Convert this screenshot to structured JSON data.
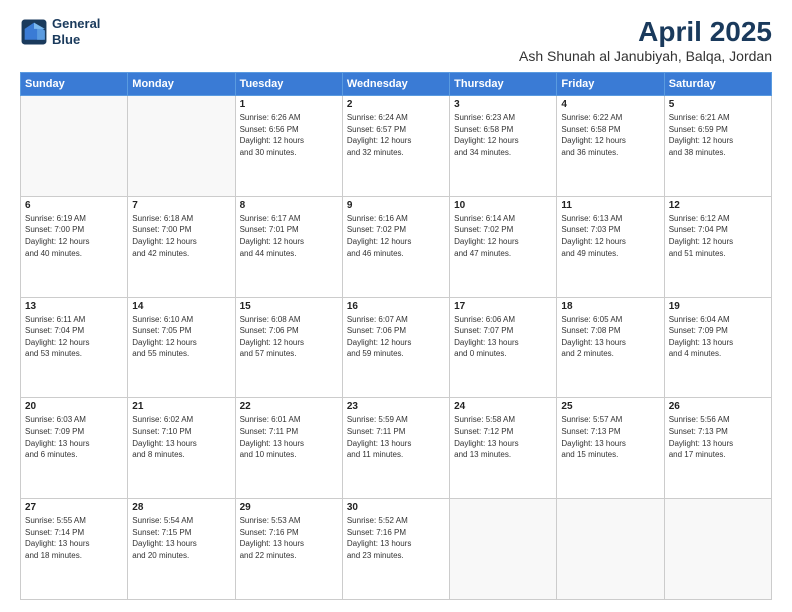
{
  "logo": {
    "line1": "General",
    "line2": "Blue"
  },
  "title": "April 2025",
  "location": "Ash Shunah al Janubiyah, Balqa, Jordan",
  "days_header": [
    "Sunday",
    "Monday",
    "Tuesday",
    "Wednesday",
    "Thursday",
    "Friday",
    "Saturday"
  ],
  "weeks": [
    [
      {
        "day": "",
        "info": ""
      },
      {
        "day": "",
        "info": ""
      },
      {
        "day": "1",
        "info": "Sunrise: 6:26 AM\nSunset: 6:56 PM\nDaylight: 12 hours\nand 30 minutes."
      },
      {
        "day": "2",
        "info": "Sunrise: 6:24 AM\nSunset: 6:57 PM\nDaylight: 12 hours\nand 32 minutes."
      },
      {
        "day": "3",
        "info": "Sunrise: 6:23 AM\nSunset: 6:58 PM\nDaylight: 12 hours\nand 34 minutes."
      },
      {
        "day": "4",
        "info": "Sunrise: 6:22 AM\nSunset: 6:58 PM\nDaylight: 12 hours\nand 36 minutes."
      },
      {
        "day": "5",
        "info": "Sunrise: 6:21 AM\nSunset: 6:59 PM\nDaylight: 12 hours\nand 38 minutes."
      }
    ],
    [
      {
        "day": "6",
        "info": "Sunrise: 6:19 AM\nSunset: 7:00 PM\nDaylight: 12 hours\nand 40 minutes."
      },
      {
        "day": "7",
        "info": "Sunrise: 6:18 AM\nSunset: 7:00 PM\nDaylight: 12 hours\nand 42 minutes."
      },
      {
        "day": "8",
        "info": "Sunrise: 6:17 AM\nSunset: 7:01 PM\nDaylight: 12 hours\nand 44 minutes."
      },
      {
        "day": "9",
        "info": "Sunrise: 6:16 AM\nSunset: 7:02 PM\nDaylight: 12 hours\nand 46 minutes."
      },
      {
        "day": "10",
        "info": "Sunrise: 6:14 AM\nSunset: 7:02 PM\nDaylight: 12 hours\nand 47 minutes."
      },
      {
        "day": "11",
        "info": "Sunrise: 6:13 AM\nSunset: 7:03 PM\nDaylight: 12 hours\nand 49 minutes."
      },
      {
        "day": "12",
        "info": "Sunrise: 6:12 AM\nSunset: 7:04 PM\nDaylight: 12 hours\nand 51 minutes."
      }
    ],
    [
      {
        "day": "13",
        "info": "Sunrise: 6:11 AM\nSunset: 7:04 PM\nDaylight: 12 hours\nand 53 minutes."
      },
      {
        "day": "14",
        "info": "Sunrise: 6:10 AM\nSunset: 7:05 PM\nDaylight: 12 hours\nand 55 minutes."
      },
      {
        "day": "15",
        "info": "Sunrise: 6:08 AM\nSunset: 7:06 PM\nDaylight: 12 hours\nand 57 minutes."
      },
      {
        "day": "16",
        "info": "Sunrise: 6:07 AM\nSunset: 7:06 PM\nDaylight: 12 hours\nand 59 minutes."
      },
      {
        "day": "17",
        "info": "Sunrise: 6:06 AM\nSunset: 7:07 PM\nDaylight: 13 hours\nand 0 minutes."
      },
      {
        "day": "18",
        "info": "Sunrise: 6:05 AM\nSunset: 7:08 PM\nDaylight: 13 hours\nand 2 minutes."
      },
      {
        "day": "19",
        "info": "Sunrise: 6:04 AM\nSunset: 7:09 PM\nDaylight: 13 hours\nand 4 minutes."
      }
    ],
    [
      {
        "day": "20",
        "info": "Sunrise: 6:03 AM\nSunset: 7:09 PM\nDaylight: 13 hours\nand 6 minutes."
      },
      {
        "day": "21",
        "info": "Sunrise: 6:02 AM\nSunset: 7:10 PM\nDaylight: 13 hours\nand 8 minutes."
      },
      {
        "day": "22",
        "info": "Sunrise: 6:01 AM\nSunset: 7:11 PM\nDaylight: 13 hours\nand 10 minutes."
      },
      {
        "day": "23",
        "info": "Sunrise: 5:59 AM\nSunset: 7:11 PM\nDaylight: 13 hours\nand 11 minutes."
      },
      {
        "day": "24",
        "info": "Sunrise: 5:58 AM\nSunset: 7:12 PM\nDaylight: 13 hours\nand 13 minutes."
      },
      {
        "day": "25",
        "info": "Sunrise: 5:57 AM\nSunset: 7:13 PM\nDaylight: 13 hours\nand 15 minutes."
      },
      {
        "day": "26",
        "info": "Sunrise: 5:56 AM\nSunset: 7:13 PM\nDaylight: 13 hours\nand 17 minutes."
      }
    ],
    [
      {
        "day": "27",
        "info": "Sunrise: 5:55 AM\nSunset: 7:14 PM\nDaylight: 13 hours\nand 18 minutes."
      },
      {
        "day": "28",
        "info": "Sunrise: 5:54 AM\nSunset: 7:15 PM\nDaylight: 13 hours\nand 20 minutes."
      },
      {
        "day": "29",
        "info": "Sunrise: 5:53 AM\nSunset: 7:16 PM\nDaylight: 13 hours\nand 22 minutes."
      },
      {
        "day": "30",
        "info": "Sunrise: 5:52 AM\nSunset: 7:16 PM\nDaylight: 13 hours\nand 23 minutes."
      },
      {
        "day": "",
        "info": ""
      },
      {
        "day": "",
        "info": ""
      },
      {
        "day": "",
        "info": ""
      }
    ]
  ]
}
